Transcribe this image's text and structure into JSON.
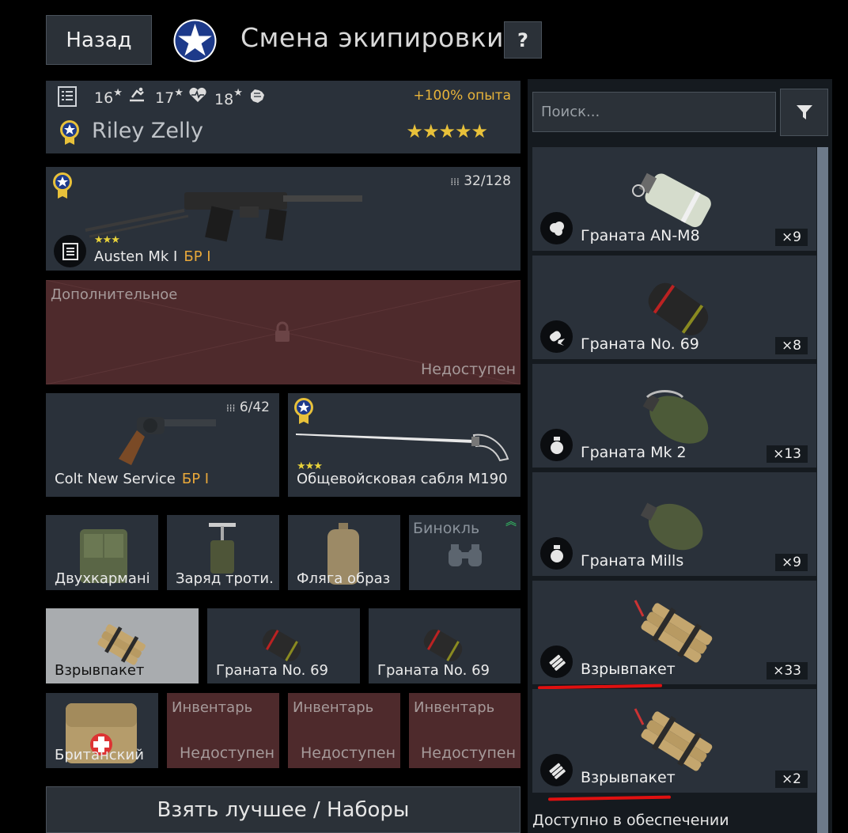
{
  "header": {
    "back_label": "Назад",
    "title": "Смена экипировки",
    "help_label": "?"
  },
  "soldier": {
    "stat1": "16",
    "stat2": "17",
    "stat3": "18",
    "xp_bonus": "+100% опыта",
    "name": "Riley Zelly",
    "rating_stars": 5
  },
  "primary": {
    "name": "Austen Mk I",
    "br": "БР I",
    "ammo": "32/128",
    "stars": 3
  },
  "secondary_slot": {
    "title": "Дополнительное",
    "status": "Недоступен"
  },
  "sidearm": {
    "name": "Colt New Service",
    "br": "БР I",
    "ammo": "6/42"
  },
  "melee": {
    "name": "Общевойсковая сабля M190",
    "stars": 3
  },
  "gear": [
    {
      "label": "Двухкармані"
    },
    {
      "label": "Заряд троти."
    },
    {
      "label": "Фляга образ"
    },
    {
      "label": "Бинокль"
    }
  ],
  "grenades": [
    {
      "label": "Взрывпакет"
    },
    {
      "label": "Граната No. 69"
    },
    {
      "label": "Граната No. 69"
    }
  ],
  "inventory": [
    {
      "label": "Британский"
    },
    {
      "title": "Инвентарь",
      "status": "Недоступен"
    },
    {
      "title": "Инвентарь",
      "status": "Недоступен"
    },
    {
      "title": "Инвентарь",
      "status": "Недоступен"
    }
  ],
  "bottom_button": "Взять лучшее / Наборы",
  "search": {
    "placeholder": "Поиск..."
  },
  "items": [
    {
      "name": "Граната AN-M8",
      "count": "×9"
    },
    {
      "name": "Граната No. 69",
      "count": "×8"
    },
    {
      "name": "Граната Mk 2",
      "count": "×13"
    },
    {
      "name": "Граната Mills",
      "count": "×9"
    },
    {
      "name": "Взрывпакет",
      "count": "×33"
    },
    {
      "name": "Взрывпакет",
      "count": "×2"
    }
  ],
  "available_label": "Доступно в обеспечении",
  "colors": {
    "accent_orange": "#e8a83a",
    "locked_red": "#4e2a2c",
    "panel": "#2a313a",
    "annotation_red": "#e01010"
  }
}
